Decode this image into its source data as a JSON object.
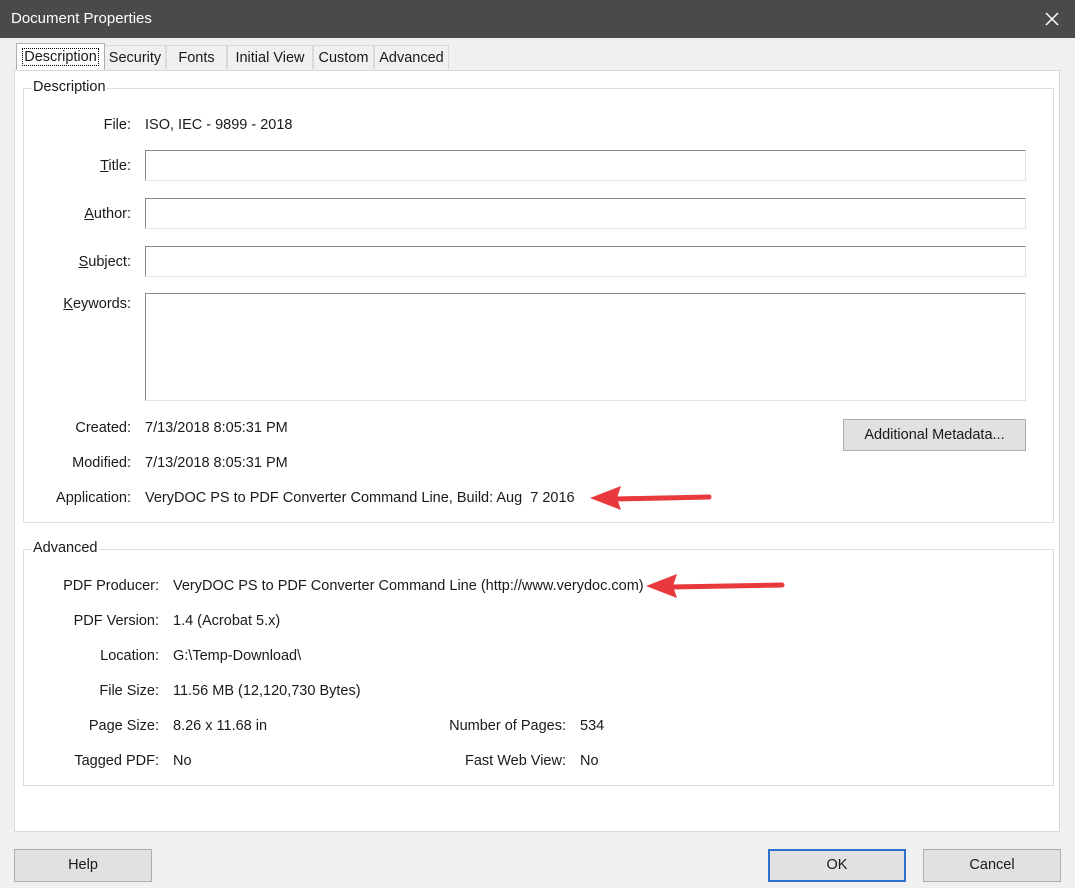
{
  "window": {
    "title": "Document Properties"
  },
  "tabs": [
    "Description",
    "Security",
    "Fonts",
    "Initial View",
    "Custom",
    "Advanced"
  ],
  "description": {
    "legend": "Description",
    "file_label": "File:",
    "file_value": "ISO, IEC - 9899 - 2018",
    "title_label": "Title:",
    "title_value": "",
    "author_label": "Author:",
    "author_value": "",
    "subject_label": "Subject:",
    "subject_value": "",
    "keywords_label": "Keywords:",
    "keywords_value": "",
    "created_label": "Created:",
    "created_value": "7/13/2018 8:05:31 PM",
    "modified_label": "Modified:",
    "modified_value": "7/13/2018 8:05:31 PM",
    "application_label": "Application:",
    "application_value": "VeryDOC PS to PDF Converter Command Line, Build: Aug  7 2016",
    "additional_metadata_label": "Additional Metadata..."
  },
  "advanced": {
    "legend": "Advanced",
    "producer_label": "PDF Producer:",
    "producer_value": "VeryDOC PS to PDF Converter Command Line (http://www.verydoc.com)",
    "version_label": "PDF Version:",
    "version_value": "1.4 (Acrobat 5.x)",
    "location_label": "Location:",
    "location_value": "G:\\Temp-Download\\",
    "filesize_label": "File Size:",
    "filesize_value": "11.56 MB (12,120,730 Bytes)",
    "pagesize_label": "Page Size:",
    "pagesize_value": "8.26 x 11.68 in",
    "numpages_label": "Number of Pages:",
    "numpages_value": "534",
    "tagged_label": "Tagged PDF:",
    "tagged_value": "No",
    "fastweb_label": "Fast Web View:",
    "fastweb_value": "No"
  },
  "footer": {
    "help_label": "Help",
    "ok_label": "OK",
    "cancel_label": "Cancel"
  },
  "colors": {
    "titlebar": "#4a4a4a",
    "annotation_arrow": "#e8393d",
    "default_button_border": "#2f6fcd"
  }
}
